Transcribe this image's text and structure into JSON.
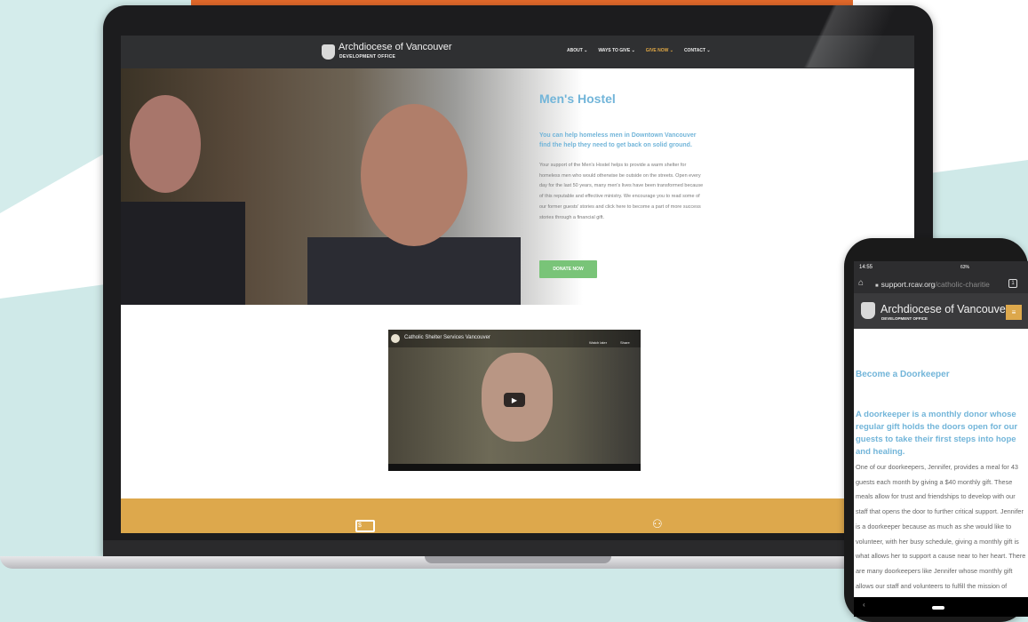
{
  "laptop": {
    "header": {
      "logo_title": "Archdiocese of Vancouver",
      "logo_subtitle": "DEVELOPMENT OFFICE",
      "nav": [
        {
          "label": "ABOUT ⌄",
          "active": false
        },
        {
          "label": "WAYS TO GIVE ⌄",
          "active": false
        },
        {
          "label": "GIVE NOW ⌄",
          "active": true
        },
        {
          "label": "CONTACT ⌄",
          "active": false
        }
      ]
    },
    "hero": {
      "title": "Men's Hostel",
      "subtitle": "You can help homeless men in Downtown Vancouver find the help they need to get back on solid ground.",
      "body": "Your support of the Men's Hostel helps to provide a warm shelter for homeless men who would otherwise be outside on the streets. Open every day for the last 50 years, many men's lives have been transformed because of this reputable and effective ministry. We encourage you to read some of our former guests' stories and click here to become a part of more success stories through a financial gift.",
      "cta_label": "DONATE NOW"
    },
    "video": {
      "title": "Catholic Shelter Services Vancouver",
      "watch_later": "Watch later",
      "share": "Share"
    }
  },
  "phone": {
    "status": {
      "time": "14:55",
      "battery": "63%"
    },
    "url": {
      "domain": "support.rcav.org",
      "path": "/catholic-charitie"
    },
    "tab_count": "1",
    "header": {
      "logo_title": "Archdiocese of Vancouver",
      "logo_subtitle": "DEVELOPMENT OFFICE"
    },
    "heading": "Become a Doorkeeper",
    "subheading": "A doorkeeper is a monthly donor whose regular gift holds the doors open for our guests to take their first steps into hope and healing.",
    "body": "One of our doorkeepers, Jennifer, provides a meal for 43 guests each month by giving a $40 monthly gift. These meals allow for trust and friendships to develop with our staff that opens the door to further critical support. Jennifer is a doorkeeper because as much as she would like to volunteer, with her busy schedule, giving a monthly gift is what allows her to support a cause near to her heart. There are many doorkeepers like Jennifer whose monthly gift allows our staff and volunteers to fulfill the mission of serving the most"
  },
  "colors": {
    "accent_blue": "#72b5d9",
    "gold": "#dda84c",
    "green_button": "#79c478",
    "header_dark": "#2f3032",
    "orange_strip": "#e46a2b"
  },
  "icons": [
    "home-icon",
    "lock-icon",
    "tab-switcher-icon",
    "menu-icon",
    "play-icon",
    "watch-later-icon",
    "share-icon",
    "money-icon",
    "people-icon",
    "back-icon"
  ]
}
